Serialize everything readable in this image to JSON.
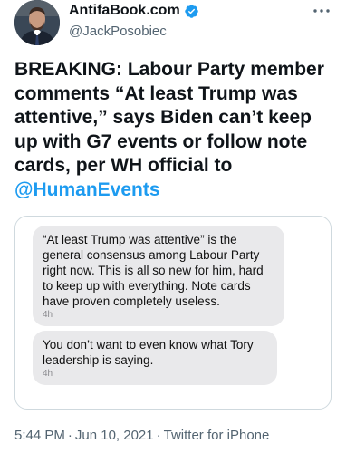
{
  "author": {
    "name": "AntifaBook.com",
    "handle": "@JackPosobiec",
    "verified": true
  },
  "tweet": {
    "text_main": "BREAKING: Labour Party member comments “At least Trump was attentive,” says Biden can’t keep up with G7 events or follow note cards, per WH official to ",
    "mention": "@HumanEvents"
  },
  "image": {
    "messages": [
      {
        "text": "“At least Trump was attentive” is the general consensus among Labour Party right now. This is all so new for him, hard to keep up with everything. Note cards have proven completely useless.",
        "time": "4h"
      },
      {
        "text": "You don’t want to even know what Tory leadership is saying.",
        "time": "4h"
      }
    ]
  },
  "meta": {
    "time": "5:44 PM",
    "date": "Jun 10, 2021",
    "source": "Twitter for iPhone",
    "separator": "·"
  },
  "colors": {
    "text": "#0f1419",
    "secondary": "#536471",
    "accent": "#1d9bf0",
    "bubble": "#e9e9eb",
    "border": "#cfd9de"
  },
  "icons": {
    "verified": "verified-badge-icon",
    "more": "more-icon"
  }
}
